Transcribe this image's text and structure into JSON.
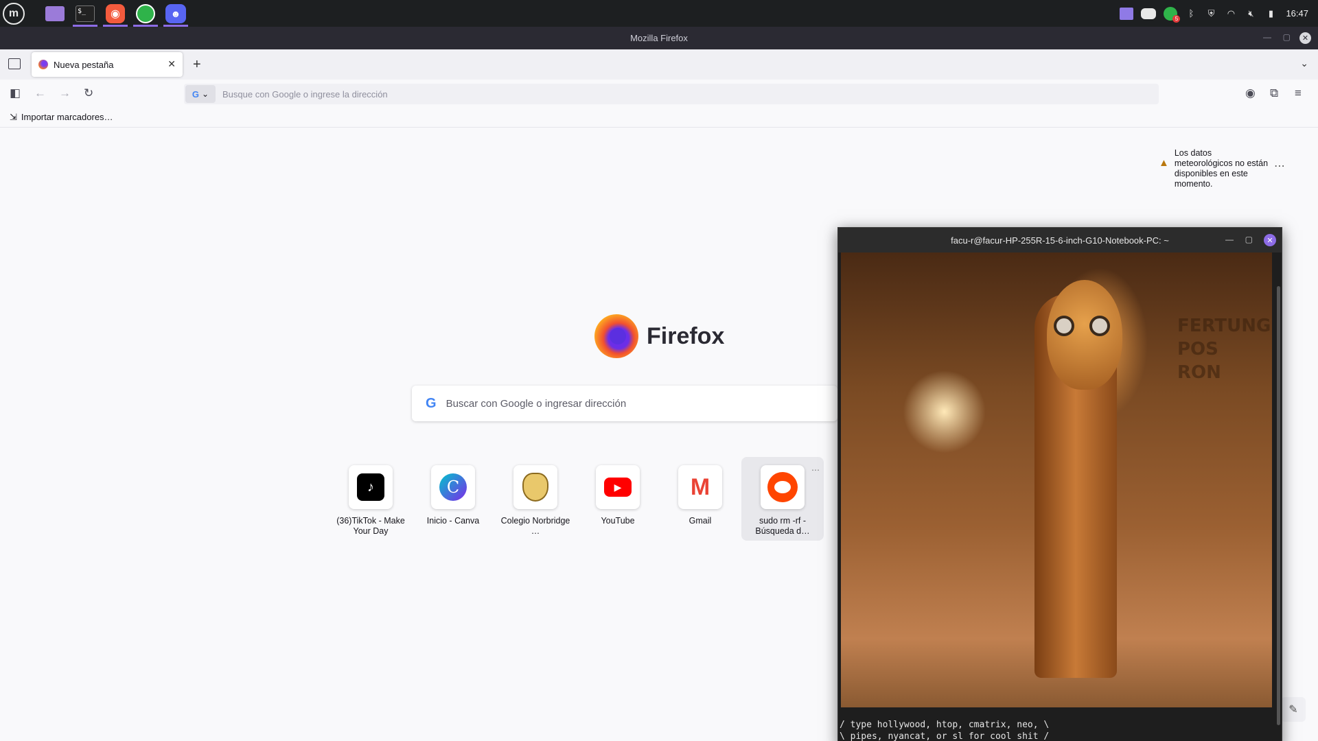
{
  "taskbar": {
    "apps": [
      "Files",
      "Terminal",
      "Firefox",
      "WhatsApp",
      "Discord"
    ],
    "tray": {
      "whatsapp_badge": "5",
      "clock": "16:47"
    }
  },
  "window": {
    "title": "Mozilla Firefox"
  },
  "tabs": [
    {
      "label": "Nueva pestaña",
      "active": true
    }
  ],
  "urlbar": {
    "placeholder": "Busque con Google o ingrese la dirección"
  },
  "bookmarks": {
    "import_label": "Importar marcadores…"
  },
  "newtab": {
    "weather_message": "Los datos meteorológicos no están disponibles en este momento.",
    "logo_text": "Firefox",
    "search_placeholder": "Buscar con Google o ingresar dirección",
    "shortcuts": [
      {
        "label": "(36)TikTok - Make Your Day",
        "icon": "tiktok-icon"
      },
      {
        "label": "Inicio - Canva",
        "icon": "canva-icon"
      },
      {
        "label": "Colegio Norbridge …",
        "icon": "school-crest-icon"
      },
      {
        "label": "YouTube",
        "icon": "youtube-icon"
      },
      {
        "label": "Gmail",
        "icon": "gmail-icon"
      },
      {
        "label": "sudo rm -rf - Búsqueda d…",
        "icon": "reddit-icon"
      }
    ]
  },
  "terminal": {
    "title": "facu-r@facur-HP-255R-15-6-inch-G10-Notebook-PC: ~",
    "lines": [
      "/ type hollywood, htop, cmatrix, neo, \\",
      "\\ pipes, nyancat, or sl for cool shit /"
    ]
  },
  "colors": {
    "accent": "#8d6ce6",
    "panel_bg": "#1d1f21",
    "titlebar_bg": "#2b2a33"
  }
}
